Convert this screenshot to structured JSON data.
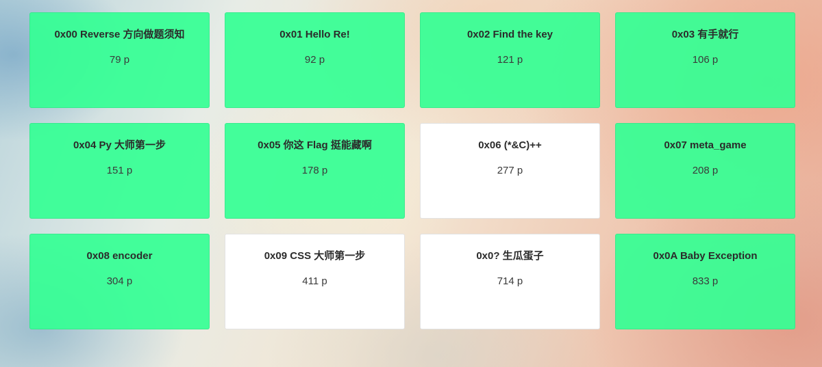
{
  "challenges": [
    {
      "title": "0x00 Reverse 方向做题须知",
      "points": "79 p",
      "status": "solved"
    },
    {
      "title": "0x01 Hello Re!",
      "points": "92 p",
      "status": "solved"
    },
    {
      "title": "0x02 Find the key",
      "points": "121 p",
      "status": "solved"
    },
    {
      "title": "0x03 有手就行",
      "points": "106 p",
      "status": "solved"
    },
    {
      "title": "0x04 Py 大师第一步",
      "points": "151 p",
      "status": "solved"
    },
    {
      "title": "0x05 你这 Flag 挺能藏啊",
      "points": "178 p",
      "status": "solved"
    },
    {
      "title": "0x06 (*&C)++",
      "points": "277 p",
      "status": "unsolved"
    },
    {
      "title": "0x07 meta_game",
      "points": "208 p",
      "status": "solved"
    },
    {
      "title": "0x08 encoder",
      "points": "304 p",
      "status": "solved"
    },
    {
      "title": "0x09 CSS 大师第一步",
      "points": "411 p",
      "status": "unsolved"
    },
    {
      "title": "0x0? 生瓜蛋子",
      "points": "714 p",
      "status": "unsolved"
    },
    {
      "title": "0x0A Baby Exception",
      "points": "833 p",
      "status": "solved"
    }
  ],
  "colors": {
    "solved_card": "#34ff94",
    "unsolved_card": "#ffffff",
    "text": "#2b2b2b"
  }
}
